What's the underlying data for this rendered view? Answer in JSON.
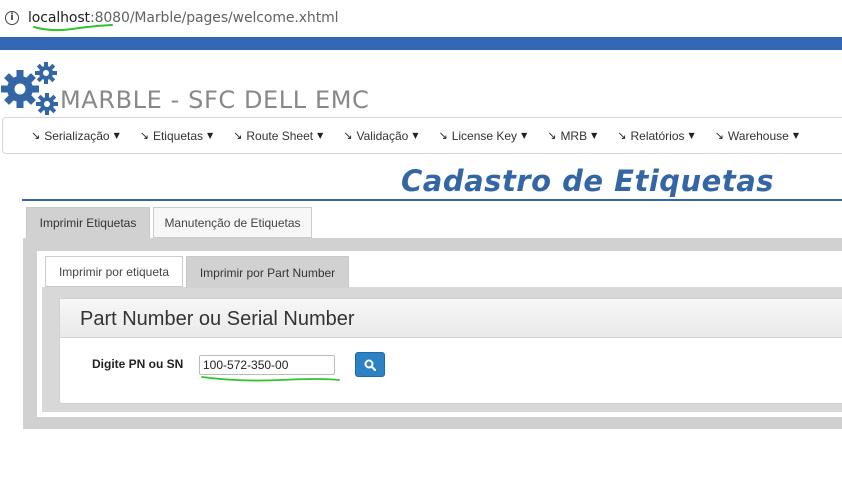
{
  "browser": {
    "url_host": "localhost",
    "url_port": ":8080",
    "url_path": "/Marble/pages/welcome.xhtml",
    "info_icon": "info-icon"
  },
  "header": {
    "app_title": "MARBLE - SFC DELL EMC",
    "logo_icon": "gears-icon",
    "logo_color": "#3466a6"
  },
  "menu": {
    "items": [
      {
        "label": "Serialização"
      },
      {
        "label": "Etiquetas"
      },
      {
        "label": "Route Sheet"
      },
      {
        "label": "Validação"
      },
      {
        "label": "License Key"
      },
      {
        "label": "MRB"
      },
      {
        "label": "Relatórios"
      },
      {
        "label": "Warehouse"
      }
    ]
  },
  "page": {
    "title": "Cadastro de Etiquetas",
    "title_color": "#3466a6"
  },
  "outer_tabs": [
    {
      "label": "Imprimir Etiquetas",
      "active": true
    },
    {
      "label": "Manutenção de Etiquetas",
      "active": false
    }
  ],
  "inner_tabs": [
    {
      "label": "Imprimir por etiqueta",
      "active": false
    },
    {
      "label": "Imprimir por Part Number",
      "active": true
    }
  ],
  "form": {
    "legend": "Part Number ou Serial Number",
    "field_label": "Digite PN ou SN",
    "field_value": "100-572-350-00",
    "search_icon": "search-icon",
    "button_color": "#2d82c5"
  }
}
